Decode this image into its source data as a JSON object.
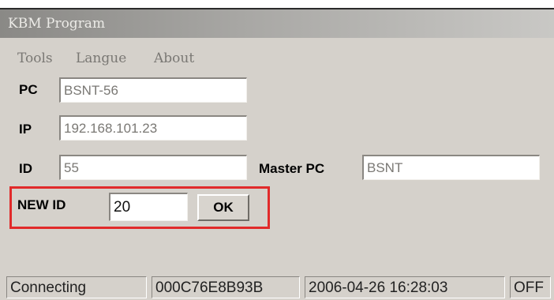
{
  "window": {
    "title": "KBM Program"
  },
  "menu": {
    "items": [
      "Tools",
      "Langue",
      "About"
    ]
  },
  "form": {
    "pc_label": "PC",
    "pc_value": "BSNT-56",
    "ip_label": "IP",
    "ip_value": "192.168.101.23",
    "id_label": "ID",
    "id_value": "55",
    "master_pc_label": "Master PC",
    "master_pc_value": "BSNT",
    "new_id_label": "NEW ID",
    "new_id_value": "20",
    "ok_label": "OK"
  },
  "status": {
    "connection": "Connecting",
    "mac": "000C76E8B93B",
    "datetime": "2006-04-26 16:28:03",
    "state": "OFF"
  },
  "colors": {
    "highlight": "#e12a2a",
    "window_bg": "#d5d1cb"
  }
}
